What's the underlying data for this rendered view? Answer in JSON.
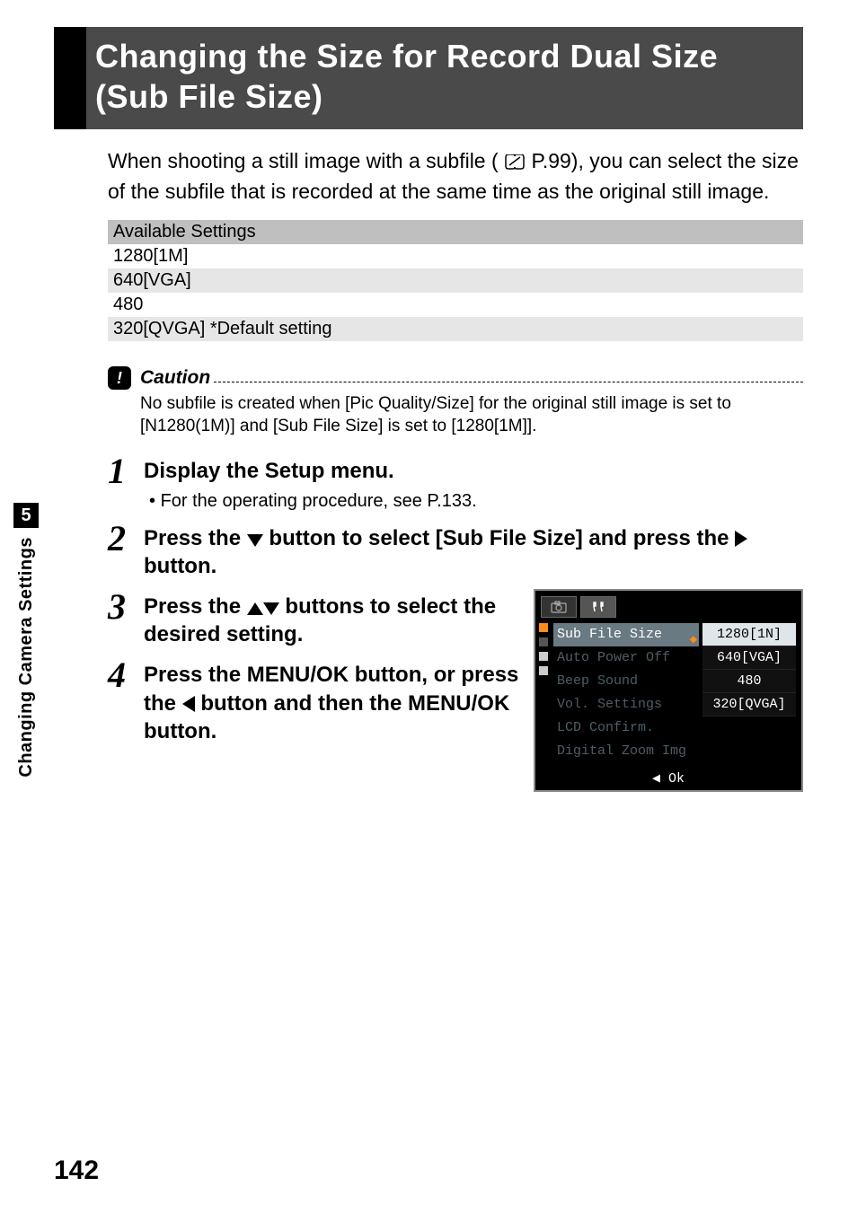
{
  "heading": "Changing the Size for Record Dual Size (Sub File Size)",
  "intro": {
    "pre": "When shooting a still image with a subfile (",
    "ref": "P.99",
    "post": "), you can select the size of the subfile that is recorded at the same time as the original still image."
  },
  "table": {
    "header": "Available Settings",
    "rows": [
      "1280[1M]",
      "640[VGA]",
      "480",
      "320[QVGA] *Default setting"
    ]
  },
  "caution": {
    "label": "Caution",
    "text": "No subfile is created when [Pic Quality/Size] for the original still image is set to [N1280(1M)] and [Sub File Size] is set to [1280[1M]]."
  },
  "steps": {
    "s1": {
      "num": "1",
      "title": "Display the Setup menu.",
      "sub": "For the operating procedure, see P.133."
    },
    "s2": {
      "num": "2",
      "title_pre": "Press the ",
      "title_mid": " button to select [Sub File Size] and press the ",
      "title_post": " button."
    },
    "s3": {
      "num": "3",
      "title_pre": "Press the ",
      "title_post": " buttons to select the desired setting."
    },
    "s4": {
      "num": "4",
      "title_pre": "Press the MENU/OK button, or press the ",
      "title_post": " button and then the MENU/OK button."
    }
  },
  "screenshot": {
    "tabs": {
      "cam": "📷",
      "tool": "ĳĳ"
    },
    "menu": [
      "Sub File Size",
      "Auto Power Off",
      "Beep Sound",
      "Vol. Settings",
      "LCD Confirm.",
      "Digital Zoom Img"
    ],
    "options": [
      "1280[1N]",
      "640[VGA]",
      "480",
      "320[QVGA]"
    ],
    "footer_icon": "◀",
    "footer": "Ok"
  },
  "side": {
    "chapter": "5",
    "label": "Changing Camera Settings"
  },
  "page_number": "142"
}
